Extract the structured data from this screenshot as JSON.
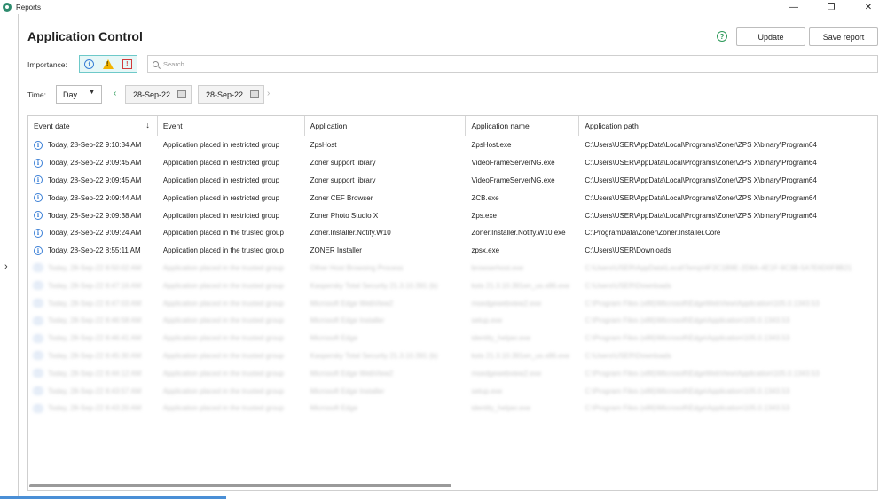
{
  "window": {
    "title": "Reports",
    "controls": [
      "—",
      "❐",
      "✕"
    ]
  },
  "page": {
    "heading": "Application Control",
    "help": "?",
    "update_label": "Update",
    "save_label": "Save report"
  },
  "filters": {
    "importance_label": "Importance:",
    "importance_icons": [
      "info-icon",
      "warning-icon",
      "critical-icon"
    ],
    "search_placeholder": "Search",
    "time_label": "Time:",
    "period_value": "Day",
    "date_from": "28-Sep-22",
    "date_to": "28-Sep-22"
  },
  "table": {
    "columns": [
      "Event date",
      "Event",
      "Application",
      "Application name",
      "Application path"
    ],
    "rows": [
      {
        "date": "Today, 28-Sep-22 9:10:34 AM",
        "event": "Application placed in restricted group",
        "app": "ZpsHost",
        "name": "ZpsHost.exe",
        "path": "C:\\Users\\USER\\AppData\\Local\\Programs\\Zoner\\ZPS X\\binary\\Program64"
      },
      {
        "date": "Today, 28-Sep-22 9:09:45 AM",
        "event": "Application placed in restricted group",
        "app": "Zoner support library",
        "name": "VideoFrameServerNG.exe",
        "path": "C:\\Users\\USER\\AppData\\Local\\Programs\\Zoner\\ZPS X\\binary\\Program64"
      },
      {
        "date": "Today, 28-Sep-22 9:09:45 AM",
        "event": "Application placed in restricted group",
        "app": "Zoner support library",
        "name": "VideoFrameServerNG.exe",
        "path": "C:\\Users\\USER\\AppData\\Local\\Programs\\Zoner\\ZPS X\\binary\\Program64"
      },
      {
        "date": "Today, 28-Sep-22 9:09:44 AM",
        "event": "Application placed in restricted group",
        "app": "Zoner CEF Browser",
        "name": "ZCB.exe",
        "path": "C:\\Users\\USER\\AppData\\Local\\Programs\\Zoner\\ZPS X\\binary\\Program64"
      },
      {
        "date": "Today, 28-Sep-22 9:09:38 AM",
        "event": "Application placed in restricted group",
        "app": "Zoner Photo Studio X",
        "name": "Zps.exe",
        "path": "C:\\Users\\USER\\AppData\\Local\\Programs\\Zoner\\ZPS X\\binary\\Program64"
      },
      {
        "date": "Today, 28-Sep-22 9:09:24 AM",
        "event": "Application placed in the trusted group",
        "app": "Zoner.Installer.Notify.W10",
        "name": "Zoner.Installer.Notify.W10.exe",
        "path": "C:\\ProgramData\\Zoner\\Zoner.Installer.Core"
      },
      {
        "date": "Today, 28-Sep-22 8:55:11 AM",
        "event": "Application placed in the trusted group",
        "app": "ZONER Installer",
        "name": "zpsx.exe",
        "path": "C:\\Users\\USER\\Downloads"
      }
    ],
    "blurred_rows": [
      {
        "date": "Today, 28-Sep-22 8:50:02 AM",
        "event": "Application placed in the trusted group",
        "app": "Other Host Browsing Process",
        "name": "browserhost.exe",
        "path": "C:\\Users\\USER\\AppData\\Local\\Temp\\4F2C1B9E-2D8A-4E1F-9C3B-5A7E6D0F8B21"
      },
      {
        "date": "Today, 28-Sep-22 8:47:16 AM",
        "event": "Application placed in the trusted group",
        "app": "Kaspersky Total Security 21.3.10.391 (b)",
        "name": "ksts 21.3.10.391en_us.x86.exe",
        "path": "C:\\Users\\USER\\Downloads"
      },
      {
        "date": "Today, 28-Sep-22 8:47:03 AM",
        "event": "Application placed in the trusted group",
        "app": "Microsoft Edge WebView2",
        "name": "msedgewebview2.exe",
        "path": "C:\\Program Files (x86)\\Microsoft\\EdgeWebView\\Application\\105.0.1343.53"
      },
      {
        "date": "Today, 28-Sep-22 8:46:58 AM",
        "event": "Application placed in the trusted group",
        "app": "Microsoft Edge Installer",
        "name": "setup.exe",
        "path": "C:\\Program Files (x86)\\Microsoft\\Edge\\Application\\105.0.1343.53"
      },
      {
        "date": "Today, 28-Sep-22 8:46:41 AM",
        "event": "Application placed in the trusted group",
        "app": "Microsoft Edge",
        "name": "identity_helper.exe",
        "path": "C:\\Program Files (x86)\\Microsoft\\Edge\\Application\\105.0.1343.53"
      },
      {
        "date": "Today, 28-Sep-22 8:45:30 AM",
        "event": "Application placed in the trusted group",
        "app": "Kaspersky Total Security 21.3.10.391 (b)",
        "name": "ksts 21.3.10.391en_us.x86.exe",
        "path": "C:\\Users\\USER\\Downloads"
      },
      {
        "date": "Today, 28-Sep-22 8:44:12 AM",
        "event": "Application placed in the trusted group",
        "app": "Microsoft Edge WebView2",
        "name": "msedgewebview2.exe",
        "path": "C:\\Program Files (x86)\\Microsoft\\EdgeWebView\\Application\\105.0.1343.53"
      },
      {
        "date": "Today, 28-Sep-22 8:43:57 AM",
        "event": "Application placed in the trusted group",
        "app": "Microsoft Edge Installer",
        "name": "setup.exe",
        "path": "C:\\Program Files (x86)\\Microsoft\\Edge\\Application\\105.0.1343.53"
      },
      {
        "date": "Today, 28-Sep-22 8:43:20 AM",
        "event": "Application placed in the trusted group",
        "app": "Microsoft Edge",
        "name": "identity_helper.exe",
        "path": "C:\\Program Files (x86)\\Microsoft\\Edge\\Application\\105.0.1343.53"
      }
    ]
  },
  "colors": {
    "accent": "#2e9a5a",
    "info": "#3a7fd6",
    "warning": "#f2b400",
    "critical": "#d23a3a"
  }
}
